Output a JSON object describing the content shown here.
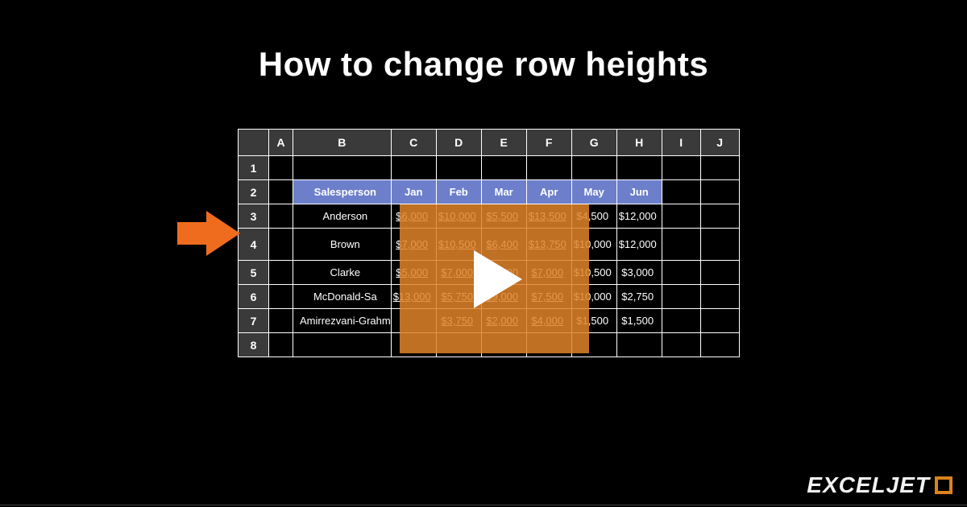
{
  "title": "How to change row heights",
  "brand": "EXCELJET",
  "columns": [
    "A",
    "B",
    "C",
    "D",
    "E",
    "F",
    "G",
    "H",
    "I",
    "J"
  ],
  "rownums": [
    "1",
    "2",
    "3",
    "4",
    "5",
    "6",
    "7",
    "8"
  ],
  "headers": {
    "b": "Salesperson",
    "c": "Jan",
    "d": "Feb",
    "e": "Mar",
    "f": "Apr",
    "g": "May",
    "h": "Jun"
  },
  "rows": {
    "r3": {
      "name": "Anderson",
      "c": "$6,000",
      "d": "$10,000",
      "e": "$5,500",
      "f": "$13,500",
      "g": "$4,500",
      "h": "$12,000"
    },
    "r4": {
      "name": "Brown",
      "c": "$7,000",
      "d": "$10,500",
      "e": "$6,400",
      "f": "$13,750",
      "g": "$10,000",
      "h": "$12,000"
    },
    "r5": {
      "name": "Clarke",
      "c": "$5,000",
      "d": "$7,000",
      "e": "$7,500",
      "f": "$7,000",
      "g": "$10,500",
      "h": "$3,000"
    },
    "r6": {
      "name": "McDonald-Sa",
      "c": "$13,000",
      "d": "$5,750",
      "e": "$9,000",
      "f": "$7,500",
      "g": "$10,000",
      "h": "$2,750"
    },
    "r7": {
      "name": "Amirrezvani-Grahm",
      "c": "",
      "d": "$3,750",
      "e": "$2,000",
      "f": "$4,000",
      "g": "$1,500",
      "h": "$1,500"
    }
  }
}
